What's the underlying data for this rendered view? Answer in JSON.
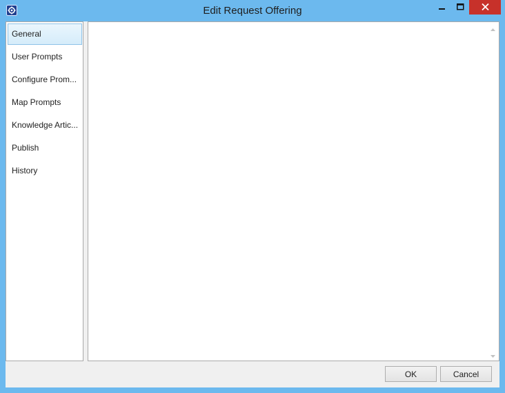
{
  "window": {
    "title": "Edit Request Offering",
    "icons": {
      "app": "app-gear-icon",
      "minimize": "minimize-icon",
      "maximize": "maximize-icon",
      "close": "close-icon"
    },
    "colors": {
      "titlebar": "#6cb9ee",
      "close_button": "#c7312a",
      "selected_item": "#d5ecfa"
    }
  },
  "nav": {
    "selected": "General",
    "items": [
      {
        "label": "General"
      },
      {
        "label": "User Prompts"
      },
      {
        "label": "Configure Prom..."
      },
      {
        "label": "Map Prompts"
      },
      {
        "label": "Knowledge Artic..."
      },
      {
        "label": "Publish"
      },
      {
        "label": "History"
      }
    ]
  },
  "footer": {
    "ok_label": "OK",
    "cancel_label": "Cancel"
  }
}
